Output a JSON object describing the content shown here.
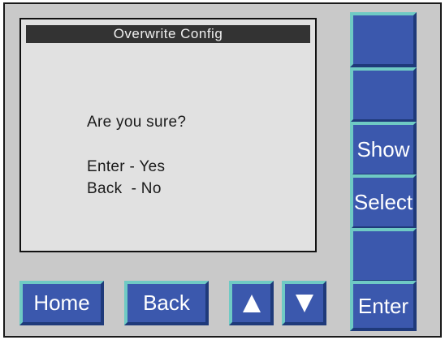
{
  "screen": {
    "title": "Overwrite Config",
    "lines": [
      "Are you sure?",
      "Enter - Yes",
      "Back  - No"
    ]
  },
  "side_buttons": [
    {
      "label": ""
    },
    {
      "label": ""
    },
    {
      "label": "Show"
    },
    {
      "label": "Select"
    },
    {
      "label": ""
    },
    {
      "label": "Enter"
    }
  ],
  "bottom_buttons": {
    "home": "Home",
    "back": "Back",
    "up_icon": "triangle-up",
    "down_icon": "triangle-down"
  },
  "colors": {
    "button_face": "#3b58ad",
    "button_highlight": "#6fcac4",
    "panel": "#c9c9c9",
    "screen_bg": "#e1e1e1",
    "title_bar": "#333333"
  }
}
